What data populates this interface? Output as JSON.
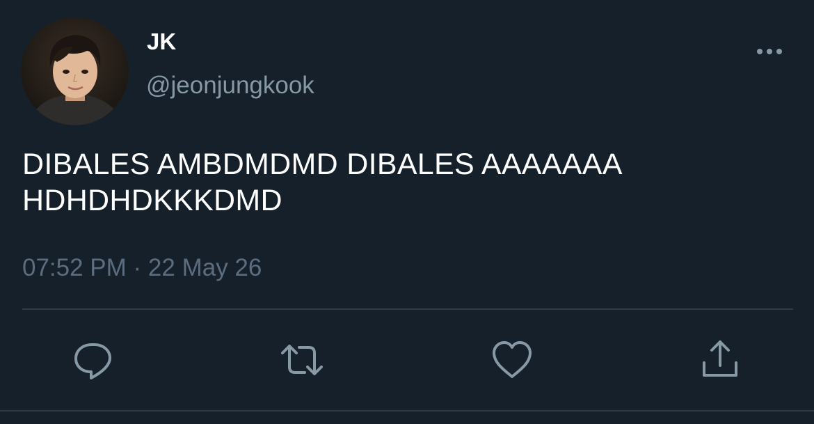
{
  "author": {
    "display_name": "JK",
    "handle": "@jeonjungkook",
    "avatar_icon": "profile-photo"
  },
  "tweet": {
    "text": "DIBALES AMBDMDMD DIBALES AAAAAAA HDHDHDKKKDMD",
    "timestamp": "07:52 PM · 22 May 26"
  },
  "actions": [
    {
      "name": "reply",
      "icon": "speech-bubble-icon"
    },
    {
      "name": "retweet",
      "icon": "retweet-arrows-icon"
    },
    {
      "name": "like",
      "icon": "heart-icon"
    },
    {
      "name": "share",
      "icon": "upload-arrow-icon"
    }
  ],
  "colors": {
    "background": "#15202b",
    "text_primary": "#ffffff",
    "text_secondary": "#8899a6",
    "icon": "#8899a6",
    "divider": "#2f3b47"
  }
}
